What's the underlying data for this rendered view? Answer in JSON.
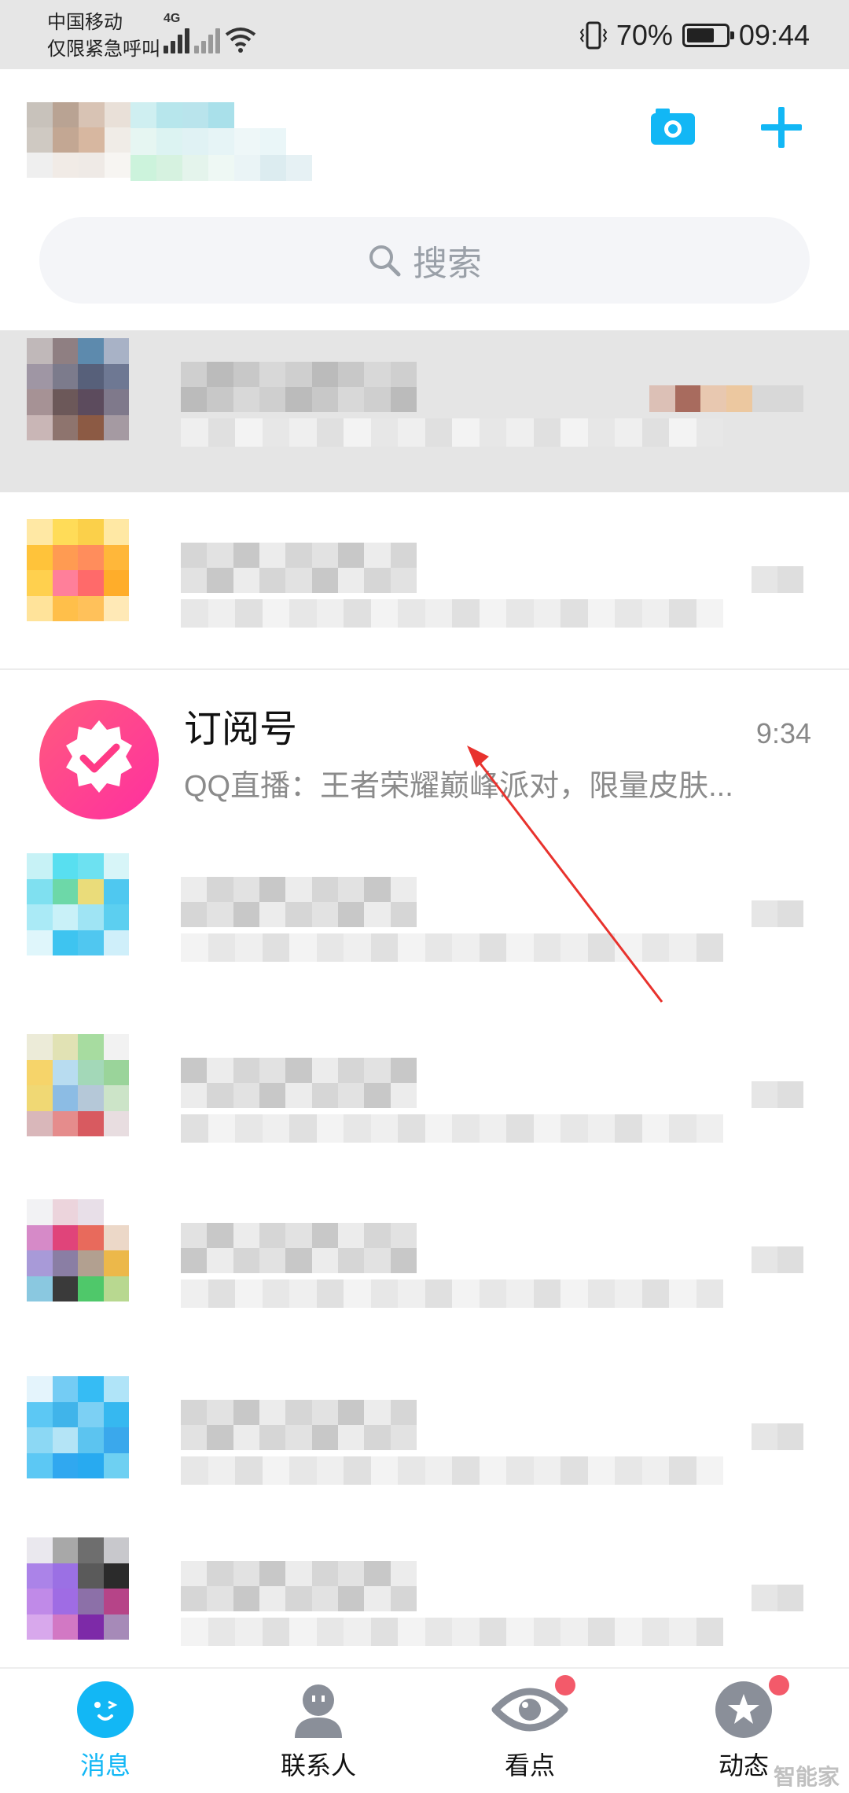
{
  "status_bar": {
    "carrier": "中国移动",
    "carrier_note": "仅限紧急呼叫",
    "network_label": "4G",
    "battery": "70%",
    "battery_level": 0.7,
    "time": "09:44"
  },
  "header": {
    "camera_icon": "camera-icon",
    "plus_icon": "plus-icon",
    "accent_color": "#12b7f5"
  },
  "search": {
    "placeholder": "搜索",
    "icon": "search-icon"
  },
  "conversation": {
    "title": "订阅号",
    "time": "9:34",
    "preview": "QQ直播：王者荣耀巅峰派对，限量皮肤..."
  },
  "tabs": [
    {
      "label": "消息",
      "icon": "message-face-icon",
      "active": true,
      "badge": false
    },
    {
      "label": "联系人",
      "icon": "contacts-icon",
      "active": false,
      "badge": false
    },
    {
      "label": "看点",
      "icon": "eye-icon",
      "active": false,
      "badge": true
    },
    {
      "label": "动态",
      "icon": "star-icon",
      "active": false,
      "badge": true
    }
  ],
  "watermark": "智能家"
}
